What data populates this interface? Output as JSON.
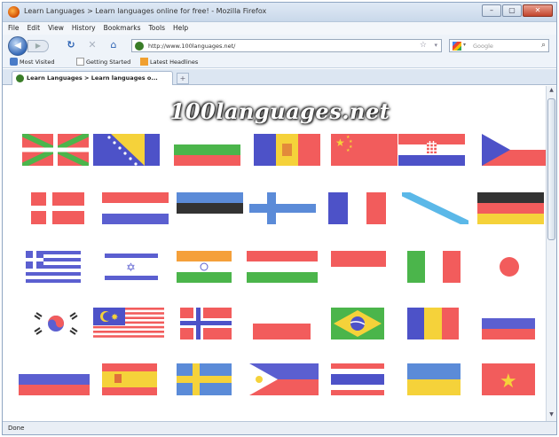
{
  "window": {
    "title": "Learn Languages > Learn languages online for free! - Mozilla Firefox"
  },
  "menu": [
    "File",
    "Edit",
    "View",
    "History",
    "Bookmarks",
    "Tools",
    "Help"
  ],
  "nav": {
    "url": "http://www.100languages.net/",
    "search_placeholder": "Google"
  },
  "bookmarks": [
    "Most Visited",
    "Getting Started",
    "Latest Headlines"
  ],
  "tab": {
    "label": "Learn Languages > Learn languages o...",
    "new_tab": "+"
  },
  "page": {
    "logo": "100languages.net"
  },
  "status": "Done",
  "flags": [
    "basque-flag-icon",
    "bosnia-flag-icon",
    "bulgaria-flag-icon",
    "andorra-flag-icon",
    "china-flag-icon",
    "croatia-flag-icon",
    "czech-flag-icon",
    "denmark-flag-icon",
    "netherlands-flag-icon",
    "estonia-flag-icon",
    "finland-flag-icon",
    "france-flag-icon",
    "galicia-flag-icon",
    "germany-flag-icon",
    "greece-flag-icon",
    "israel-flag-icon",
    "india-flag-icon",
    "hungary-flag-icon",
    "indonesia-flag-icon",
    "italy-flag-icon",
    "japan-flag-icon",
    "korea-flag-icon",
    "malaysia-flag-icon",
    "norway-flag-icon",
    "poland-flag-icon",
    "brazil-flag-icon",
    "romania-flag-icon",
    "russia-flag-icon",
    "slovenia-flag-icon",
    "spain-flag-icon",
    "sweden-flag-icon",
    "philippines-flag-icon",
    "thailand-flag-icon",
    "ukraine-flag-icon",
    "vietnam-flag-icon"
  ],
  "colors": {
    "accent": "#3b7fd6",
    "flag_red": "#f25c5c",
    "flag_blue": "#5b5fd0",
    "flag_green": "#4bb54b",
    "flag_yellow": "#f5d23a"
  }
}
